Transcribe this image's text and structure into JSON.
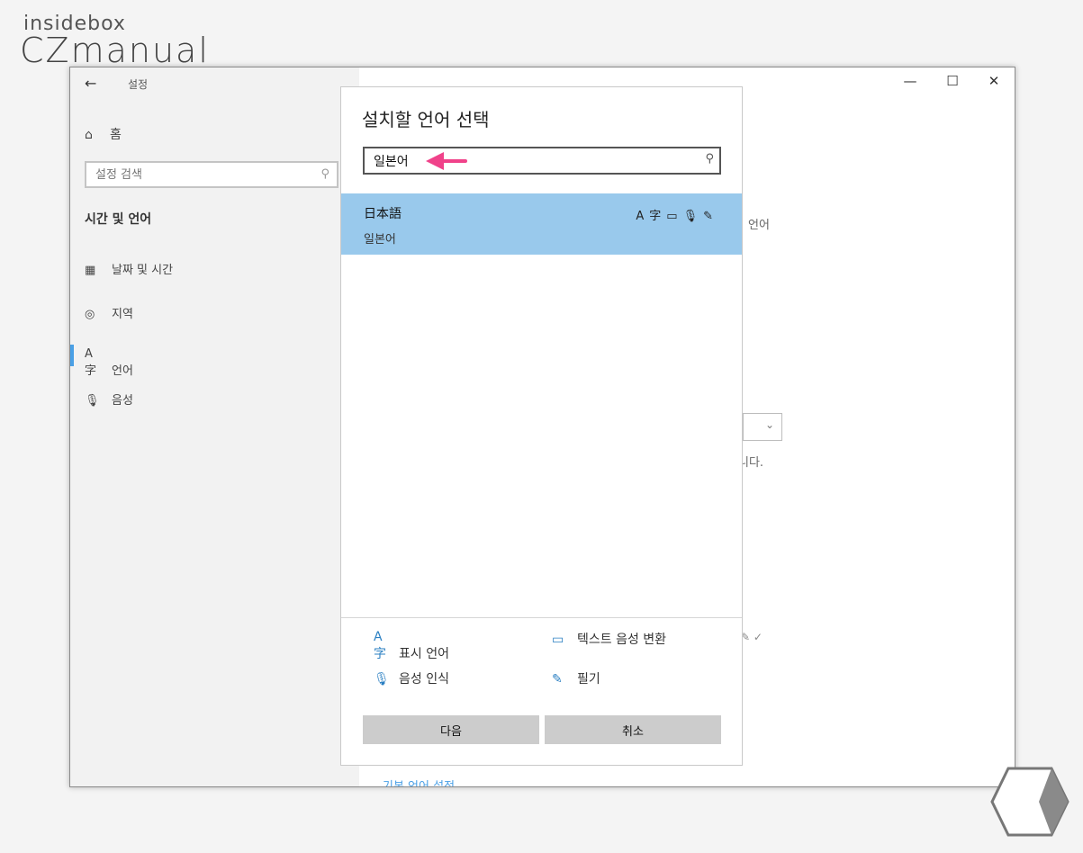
{
  "watermark": {
    "top": "insidebox",
    "main": "CZmanual"
  },
  "window": {
    "title": "설정",
    "back_icon": "arrow-left-icon",
    "controls": {
      "minimize": "—",
      "maximize": "☐",
      "close": "✕"
    }
  },
  "sidebar": {
    "home_label": "홈",
    "search_placeholder": "설정 검색",
    "section_title": "시간 및 언어",
    "items": [
      {
        "label": "날짜 및 시간",
        "icon": "calendar-clock-icon"
      },
      {
        "label": "지역",
        "icon": "globe-icon"
      },
      {
        "label": "언어",
        "icon": "language-icon"
      },
      {
        "label": "음성",
        "icon": "microphone-icon"
      }
    ]
  },
  "background": {
    "text_language": "언어",
    "text_da": "니다.",
    "link": "기본 언어 설정"
  },
  "dialog": {
    "title": "설치할 언어 선택",
    "search_value": "일본어",
    "result": {
      "native_name": "日本語",
      "korean_name": "일본어",
      "feature_icons": [
        "display-language-icon",
        "text-to-speech-icon",
        "speech-recognition-icon",
        "handwriting-icon"
      ]
    },
    "legend": [
      {
        "label": "표시 언어",
        "icon": "display-language-icon"
      },
      {
        "label": "텍스트 음성 변환",
        "icon": "text-to-speech-icon"
      },
      {
        "label": "음성 인식",
        "icon": "speech-recognition-icon"
      },
      {
        "label": "필기",
        "icon": "handwriting-icon"
      }
    ],
    "buttons": {
      "next": "다음",
      "cancel": "취소"
    }
  },
  "colors": {
    "selected_row": "#99c9ec",
    "accent": "#4aa0e6",
    "annotation_arrow": "#f0428a",
    "button_bg": "#cccccc"
  }
}
